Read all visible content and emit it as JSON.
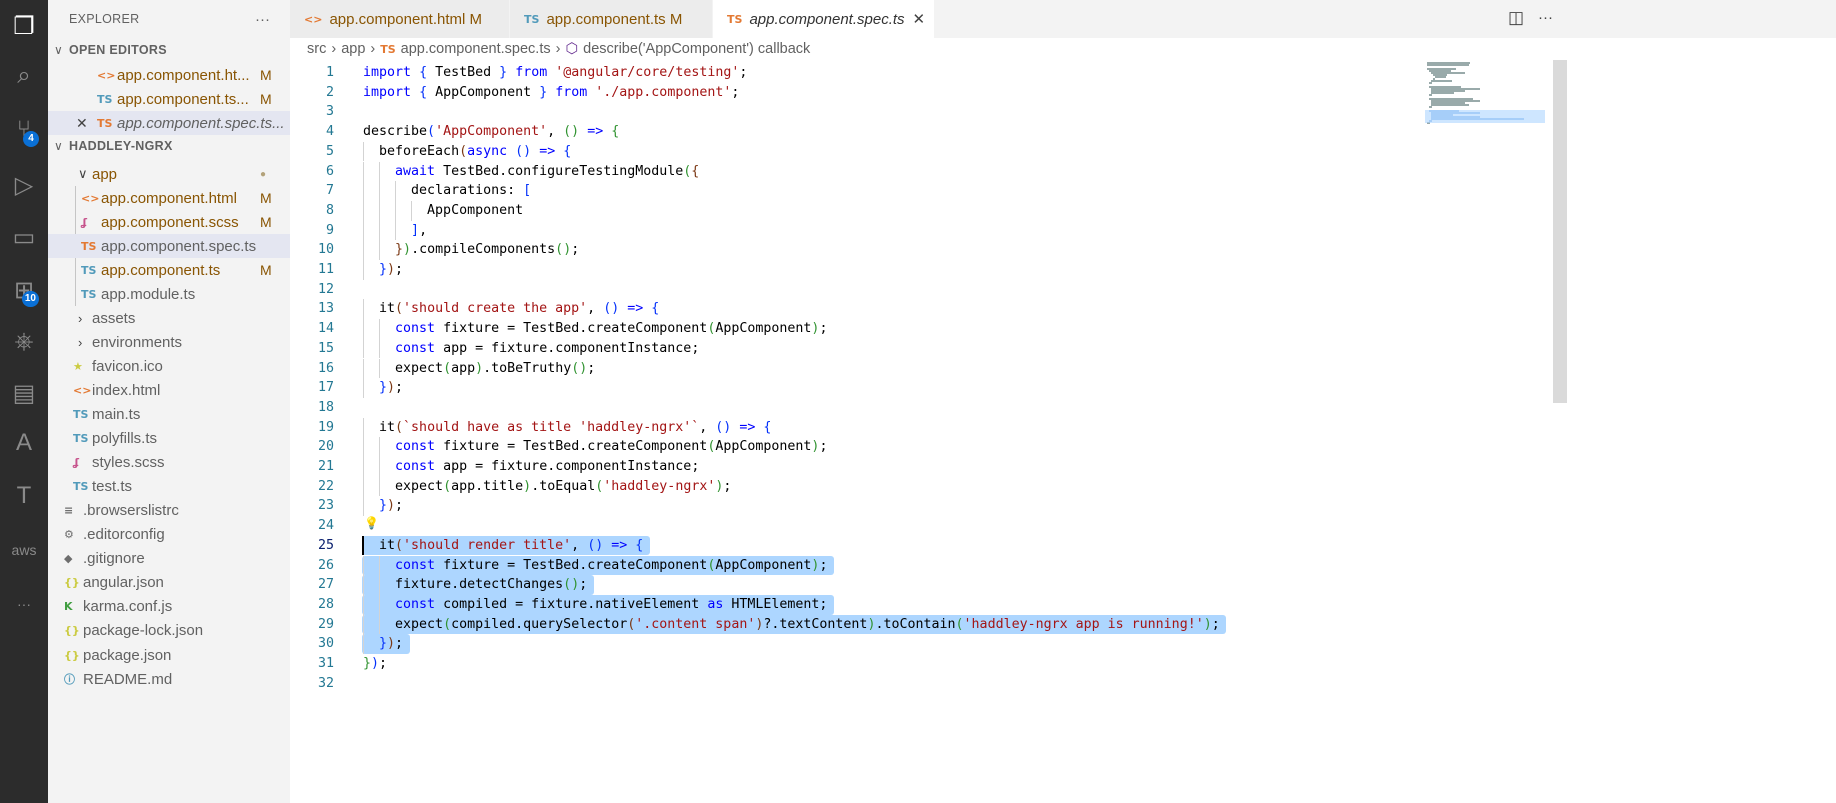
{
  "activity": [
    {
      "name": "explorer-icon",
      "g": "❐",
      "on": true
    },
    {
      "name": "search-icon",
      "g": "⌕"
    },
    {
      "name": "source-control-icon",
      "g": "⑂",
      "badge": "4"
    },
    {
      "name": "run-debug-icon",
      "g": "▷"
    },
    {
      "name": "remote-explorer-icon",
      "g": "▭"
    },
    {
      "name": "extensions-icon",
      "g": "⊞",
      "badge": "10"
    },
    {
      "name": "kubernetes-icon",
      "g": "⎈"
    },
    {
      "name": "docker-icon",
      "g": "▤"
    },
    {
      "name": "azure-icon",
      "g": "A"
    },
    {
      "name": "teams-icon",
      "g": "T"
    },
    {
      "name": "aws-icon",
      "g": "aws"
    },
    {
      "name": "more-icon",
      "g": "···"
    }
  ],
  "sidebar": {
    "title": "EXPLORER",
    "more": "···",
    "open_editors": "OPEN EDITORS",
    "open": [
      {
        "icon": "<>",
        "cls": "html",
        "label": "app.component.ht...",
        "flag": "M"
      },
      {
        "icon": "TS",
        "cls": "ts",
        "label": "app.component.ts...",
        "flag": "M"
      },
      {
        "icon": "TS",
        "cls": "tso",
        "label": "app.component.spec.ts...",
        "close": "✕"
      }
    ],
    "project": "HADDLEY-NGRX",
    "tree": [
      {
        "chev": "∨",
        "label": "app",
        "mod": true,
        "dot": "●",
        "lvl": 1
      },
      {
        "icon": "<>",
        "cls": "html",
        "label": "app.component.html",
        "flag": "M",
        "lvl": 2
      },
      {
        "icon": "ʆ",
        "cls": "scss",
        "label": "app.component.scss",
        "flag": "M",
        "lvl": 2
      },
      {
        "icon": "TS",
        "cls": "tso",
        "label": "app.component.spec.ts",
        "lvl": 2,
        "sel": true
      },
      {
        "icon": "TS",
        "cls": "ts",
        "label": "app.component.ts",
        "flag": "M",
        "lvl": 2
      },
      {
        "icon": "TS",
        "cls": "ts",
        "label": "app.module.ts",
        "lvl": 2
      },
      {
        "chev": "›",
        "label": "assets",
        "lvl": 1
      },
      {
        "chev": "›",
        "label": "environments",
        "lvl": 1
      },
      {
        "icon": "★",
        "cls": "json",
        "label": "favicon.ico",
        "lvl": 1.5
      },
      {
        "icon": "<>",
        "cls": "html",
        "label": "index.html",
        "lvl": 1.5
      },
      {
        "icon": "TS",
        "cls": "ts",
        "label": "main.ts",
        "lvl": 1.5
      },
      {
        "icon": "TS",
        "cls": "ts",
        "label": "polyfills.ts",
        "lvl": 1.5
      },
      {
        "icon": "ʆ",
        "cls": "scss",
        "label": "styles.scss",
        "lvl": 1.5
      },
      {
        "icon": "TS",
        "cls": "ts",
        "label": "test.ts",
        "lvl": 1.5
      },
      {
        "icon": "≡",
        "cls": "",
        "label": ".browserslistrc",
        "lvl": 0
      },
      {
        "icon": "⚙",
        "cls": "",
        "label": ".editorconfig",
        "lvl": 0
      },
      {
        "icon": "◆",
        "cls": "",
        "label": ".gitignore",
        "lvl": 0
      },
      {
        "icon": "{}",
        "cls": "json",
        "label": "angular.json",
        "lvl": 0
      },
      {
        "icon": "K",
        "cls": "karma",
        "label": "karma.conf.js",
        "lvl": 0
      },
      {
        "icon": "{}",
        "cls": "json",
        "label": "package-lock.json",
        "lvl": 0
      },
      {
        "icon": "{}",
        "cls": "json",
        "label": "package.json",
        "lvl": 0
      },
      {
        "icon": "ⓘ",
        "cls": "ts",
        "label": "README.md",
        "lvl": 0
      }
    ]
  },
  "tabs": [
    {
      "icon": "<>",
      "cls": "html",
      "label": "app.component.html M"
    },
    {
      "icon": "TS",
      "cls": "ts",
      "label": "app.component.ts M"
    },
    {
      "icon": "TS",
      "cls": "tso",
      "label": "app.component.spec.ts",
      "close": "✕",
      "active": true
    }
  ],
  "tab_actions": {
    "split": "◫",
    "more": "···"
  },
  "breadcrumb": [
    "src",
    "app",
    "app.component.spec.ts",
    "describe('AppComponent') callback"
  ],
  "breadcrumb_sep": "›",
  "breadcrumb_ts": "TS",
  "breadcrumb_sym": "⬡",
  "code": [
    "import { TestBed } from '@angular/core/testing';",
    "import { AppComponent } from './app.component';",
    "",
    "describe('AppComponent', () => {",
    "  beforeEach(async () => {",
    "    await TestBed.configureTestingModule({",
    "      declarations: [",
    "        AppComponent",
    "      ],",
    "    }).compileComponents();",
    "  });",
    "",
    "  it('should create the app', () => {",
    "    const fixture = TestBed.createComponent(AppComponent);",
    "    const app = fixture.componentInstance;",
    "    expect(app).toBeTruthy();",
    "  });",
    "",
    "  it(`should have as title 'haddley-ngrx'`, () => {",
    "    const fixture = TestBed.createComponent(AppComponent);",
    "    const app = fixture.componentInstance;",
    "    expect(app.title).toEqual('haddley-ngrx');",
    "  });",
    "",
    "  it('should render title', () => {",
    "    const fixture = TestBed.createComponent(AppComponent);",
    "    fixture.detectChanges();",
    "    const compiled = fixture.nativeElement as HTMLElement;",
    "    expect(compiled.querySelector('.content span')?.textContent).toContain('haddley-ngrx app is running!');",
    "  });",
    "});",
    ""
  ],
  "cursor_line": 25,
  "selection": [
    25,
    30
  ],
  "lightbulb_line": 24
}
